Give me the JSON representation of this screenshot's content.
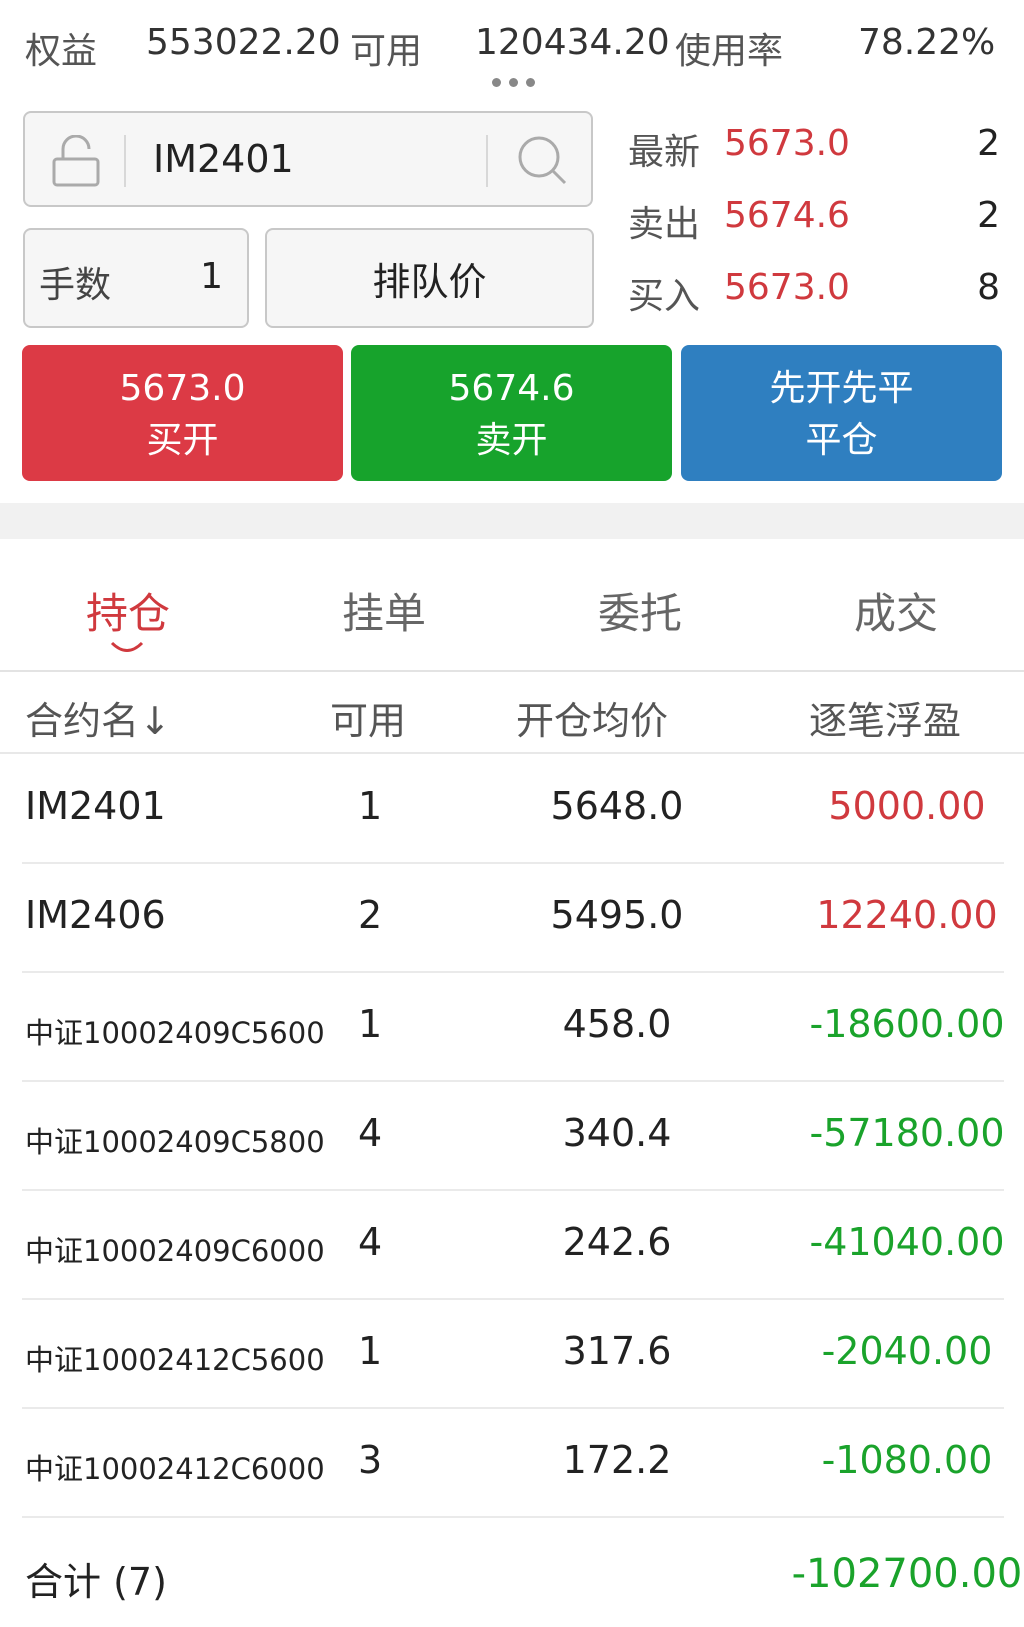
{
  "account": {
    "equity_label": "权益",
    "equity": "553022.20",
    "available_label": "可用",
    "available": "120434.20",
    "usage_label": "使用率",
    "usage": "78.22%"
  },
  "order": {
    "symbol": "IM2401",
    "qty_label": "手数",
    "qty": "1",
    "price_type": "排队价"
  },
  "quotes": [
    {
      "label": "最新",
      "price": "5673.0",
      "volume": "2"
    },
    {
      "label": "卖出",
      "price": "5674.6",
      "volume": "2"
    },
    {
      "label": "买入",
      "price": "5673.0",
      "volume": "8"
    }
  ],
  "actions": {
    "buy": {
      "price": "5673.0",
      "label": "买开"
    },
    "sell": {
      "price": "5674.6",
      "label": "卖开"
    },
    "close": {
      "line1": "先开先平",
      "label": "平仓"
    }
  },
  "tabs": [
    "持仓",
    "挂单",
    "委托",
    "成交"
  ],
  "active_tab": "持仓",
  "table": {
    "headers": [
      "合约名↓",
      "可用",
      "开仓均价",
      "逐笔浮盈"
    ],
    "rows": [
      {
        "name": "IM2401",
        "avail": "1",
        "price": "5648.0",
        "pnl": "5000.00",
        "sign": "pos"
      },
      {
        "name": "IM2406",
        "avail": "2",
        "price": "5495.0",
        "pnl": "12240.00",
        "sign": "pos"
      },
      {
        "name": "中证10002409C5600",
        "avail": "1",
        "price": "458.0",
        "pnl": "-18600.00",
        "sign": "neg"
      },
      {
        "name": "中证10002409C5800",
        "avail": "4",
        "price": "340.4",
        "pnl": "-57180.00",
        "sign": "neg"
      },
      {
        "name": "中证10002409C6000",
        "avail": "4",
        "price": "242.6",
        "pnl": "-41040.00",
        "sign": "neg"
      },
      {
        "name": "中证10002412C5600",
        "avail": "1",
        "price": "317.6",
        "pnl": "-2040.00",
        "sign": "neg"
      },
      {
        "name": "中证10002412C6000",
        "avail": "3",
        "price": "172.2",
        "pnl": "-1080.00",
        "sign": "neg"
      }
    ],
    "total_label": "合计 (7)",
    "total_pnl": "-102700.00"
  },
  "colors": {
    "up": "#d0393e",
    "down": "#1aa32b",
    "blue": "#2f7fc0"
  }
}
